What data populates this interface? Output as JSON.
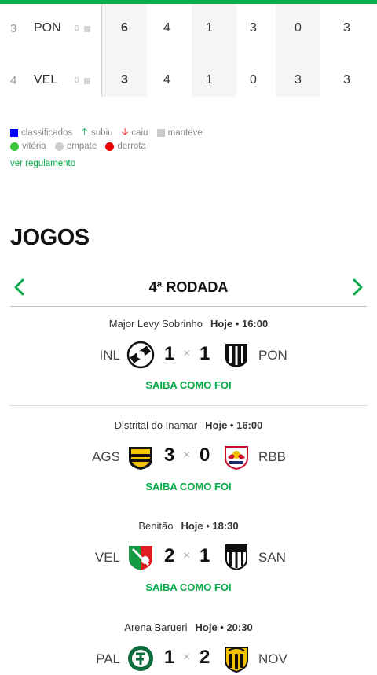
{
  "standings": {
    "rows": [
      {
        "pos": "3",
        "team": "PON",
        "var": "0",
        "cells": [
          "6",
          "4",
          "1",
          "3",
          "0",
          "3"
        ]
      },
      {
        "pos": "4",
        "team": "VEL",
        "var": "0",
        "cells": [
          "3",
          "4",
          "1",
          "0",
          "3",
          "3"
        ]
      }
    ]
  },
  "legend": {
    "classificados": "classificados",
    "subiu": "subiu",
    "caiu": "caiu",
    "manteve": "manteve",
    "vitoria": "vitória",
    "empate": "empate",
    "derrota": "derrota",
    "colors": {
      "classificados": "#0000ff",
      "vitoria": "#3bc53b",
      "empate": "#cccccc",
      "derrota": "#e60000",
      "accent": "#06aa48"
    }
  },
  "regulamento_link": "ver regulamento",
  "jogos": {
    "title": "JOGOS",
    "round": "4ª RODADA",
    "games": [
      {
        "venue": "Major Levy Sobrinho",
        "when": "Hoje • 16:00",
        "home": "INL",
        "away": "PON",
        "home_score": "1",
        "away_score": "1",
        "link": "SAIBA COMO FOI",
        "home_crest": "inter-limeira-crest-icon",
        "away_crest": "ponte-preta-crest-icon"
      },
      {
        "venue": "Distrital do Inamar",
        "when": "Hoje • 16:00",
        "home": "AGS",
        "away": "RBB",
        "home_score": "3",
        "away_score": "0",
        "link": "SAIBA COMO FOI",
        "home_crest": "agua-santa-crest-icon",
        "away_crest": "red-bull-bragantino-crest-icon"
      },
      {
        "venue": "Benitão",
        "when": "Hoje • 18:30",
        "home": "VEL",
        "away": "SAN",
        "home_score": "2",
        "away_score": "1",
        "link": "SAIBA COMO FOI",
        "home_crest": "velo-clube-crest-icon",
        "away_crest": "santos-crest-icon"
      },
      {
        "venue": "Arena Barueri",
        "when": "Hoje • 20:30",
        "home": "PAL",
        "away": "NOV",
        "home_score": "1",
        "away_score": "2",
        "link": "SAIBA COMO FOI",
        "home_crest": "palmeiras-crest-icon",
        "away_crest": "novorizontino-crest-icon"
      }
    ]
  }
}
